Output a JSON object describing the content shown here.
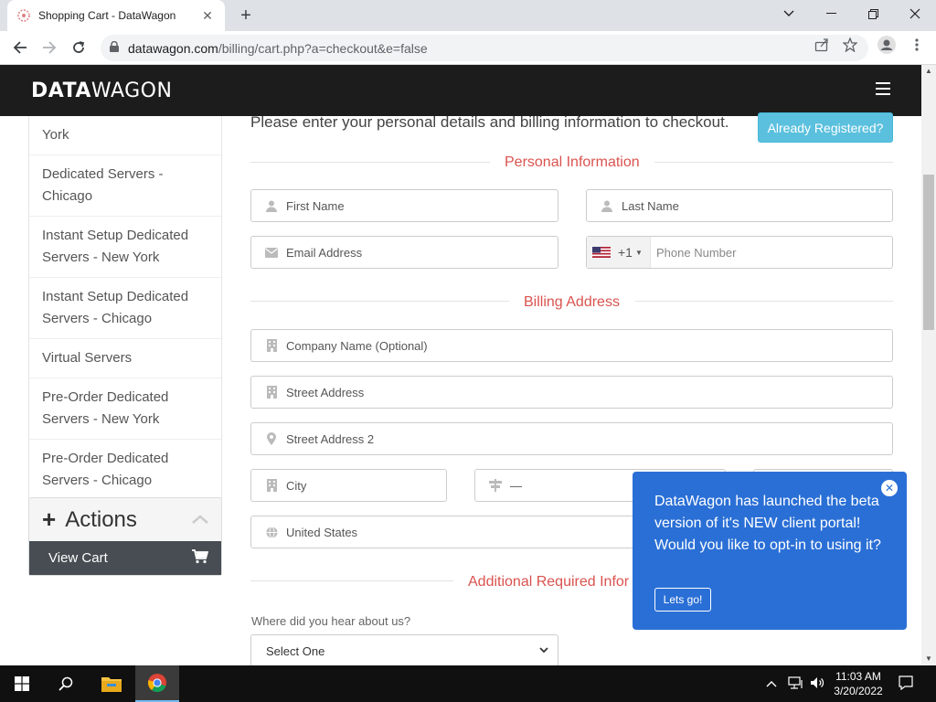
{
  "browser": {
    "tab_title": "Shopping Cart - DataWagon",
    "url_host": "datawagon.com",
    "url_path": "/billing/cart.php?a=checkout&e=false"
  },
  "site": {
    "logo_bold": "DATA",
    "logo_light": "WAGON"
  },
  "sidebar": {
    "items": [
      {
        "label": "York"
      },
      {
        "label": "Dedicated Servers - Chicago"
      },
      {
        "label": "Instant Setup Dedicated Servers - New York"
      },
      {
        "label": "Instant Setup Dedicated Servers - Chicago"
      },
      {
        "label": "Virtual Servers"
      },
      {
        "label": "Pre-Order Dedicated Servers - New York"
      },
      {
        "label": "Pre-Order Dedicated Servers - Chicago"
      }
    ],
    "actions_title": "Actions",
    "view_cart_label": "View Cart"
  },
  "main": {
    "intro": "Please enter your personal details and billing information to checkout.",
    "already_registered": "Already Registered?",
    "personal_title": "Personal Information",
    "billing_title": "Billing Address",
    "additional_title": "Additional Required Infor",
    "fields": {
      "first_name": "First Name",
      "last_name": "Last Name",
      "email": "Email Address",
      "dial_code": "+1",
      "phone": "Phone Number",
      "company": "Company Name (Optional)",
      "street": "Street Address",
      "street2": "Street Address 2",
      "city": "City",
      "state": "—",
      "country": "United States"
    },
    "hear_label": "Where did you hear about us?",
    "hear_value": "Select One"
  },
  "popup": {
    "text": "DataWagon has launched the beta version of it's NEW client portal! Would you like to opt-in to using it?",
    "button": "Lets go!"
  },
  "taskbar": {
    "time": "11:03 AM",
    "date": "3/20/2022"
  },
  "colors": {
    "accent_red": "#d9534f",
    "info_blue": "#5bc0de",
    "popup_blue": "#2a6fd6",
    "header_dark": "#1c1c1c"
  }
}
